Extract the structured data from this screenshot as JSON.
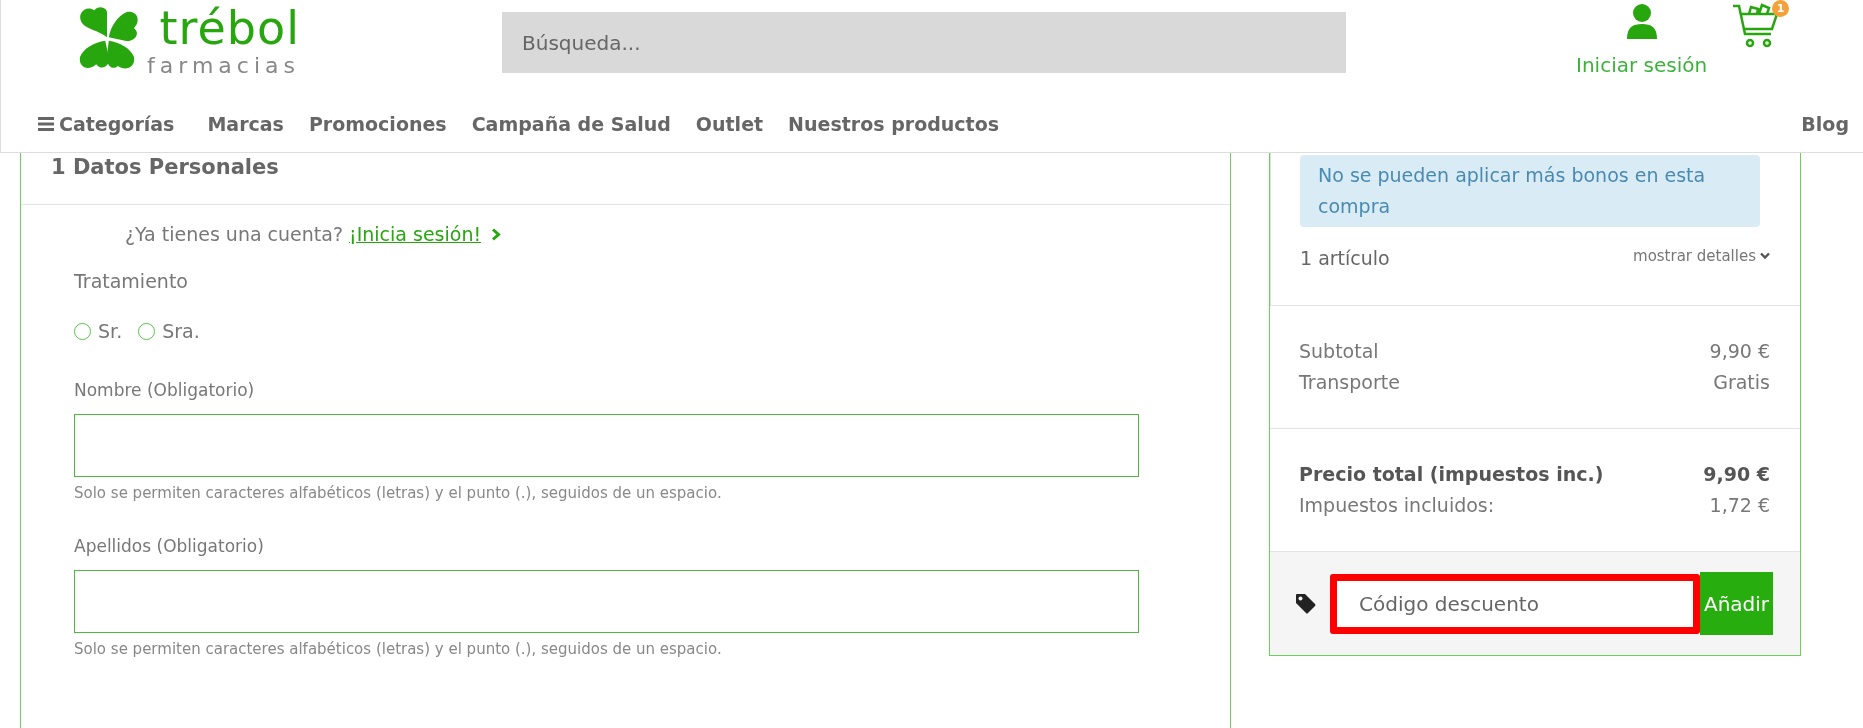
{
  "header": {
    "logo": {
      "name": "trébol",
      "tagline": "farmacias"
    },
    "search": {
      "placeholder": "Búsqueda..."
    },
    "account": {
      "label": "Iniciar sesión"
    },
    "cart": {
      "count": "1"
    }
  },
  "nav": {
    "items": [
      {
        "label": "Categorías",
        "kind": "menu"
      },
      {
        "label": "Marcas",
        "kind": "link"
      },
      {
        "label": "Promociones",
        "kind": "link"
      },
      {
        "label": "Campaña de Salud",
        "kind": "link"
      },
      {
        "label": "Outlet",
        "kind": "link"
      },
      {
        "label": "Nuestros productos",
        "kind": "link"
      }
    ],
    "blog": "Blog"
  },
  "personal": {
    "title": "1 Datos Personales",
    "login_prompt": "¿Ya tienes una cuenta?",
    "login_link": "¡Inicia sesión!",
    "treatment": {
      "label": "Tratamiento",
      "options": [
        {
          "label": "Sr.",
          "selected": false
        },
        {
          "label": "Sra.",
          "selected": false
        }
      ]
    },
    "fields": [
      {
        "label": "Nombre (Obligatorio)",
        "hint": "Solo se permiten caracteres alfabéticos (letras) y el punto (.), seguidos de un espacio."
      },
      {
        "label": "Apellidos (Obligatorio)",
        "hint": "Solo se permiten caracteres alfabéticos (letras) y el punto (.), seguidos de un espacio."
      }
    ]
  },
  "summary": {
    "notice": "No se pueden aplicar más bonos en esta compra",
    "items_count": "1 artículo",
    "details_toggle": "mostrar detalles",
    "lines": [
      {
        "label": "Subtotal",
        "value": "9,90 €"
      },
      {
        "label": "Transporte",
        "value": "Gratis"
      }
    ],
    "total": {
      "label": "Precio total (impuestos inc.)",
      "value": "9,90 €"
    },
    "taxes": {
      "label": "Impuestos incluidos:",
      "value": "1,72 €"
    },
    "discount": {
      "placeholder": "Código descuento",
      "highlighted": true,
      "button": "Añadir"
    }
  }
}
